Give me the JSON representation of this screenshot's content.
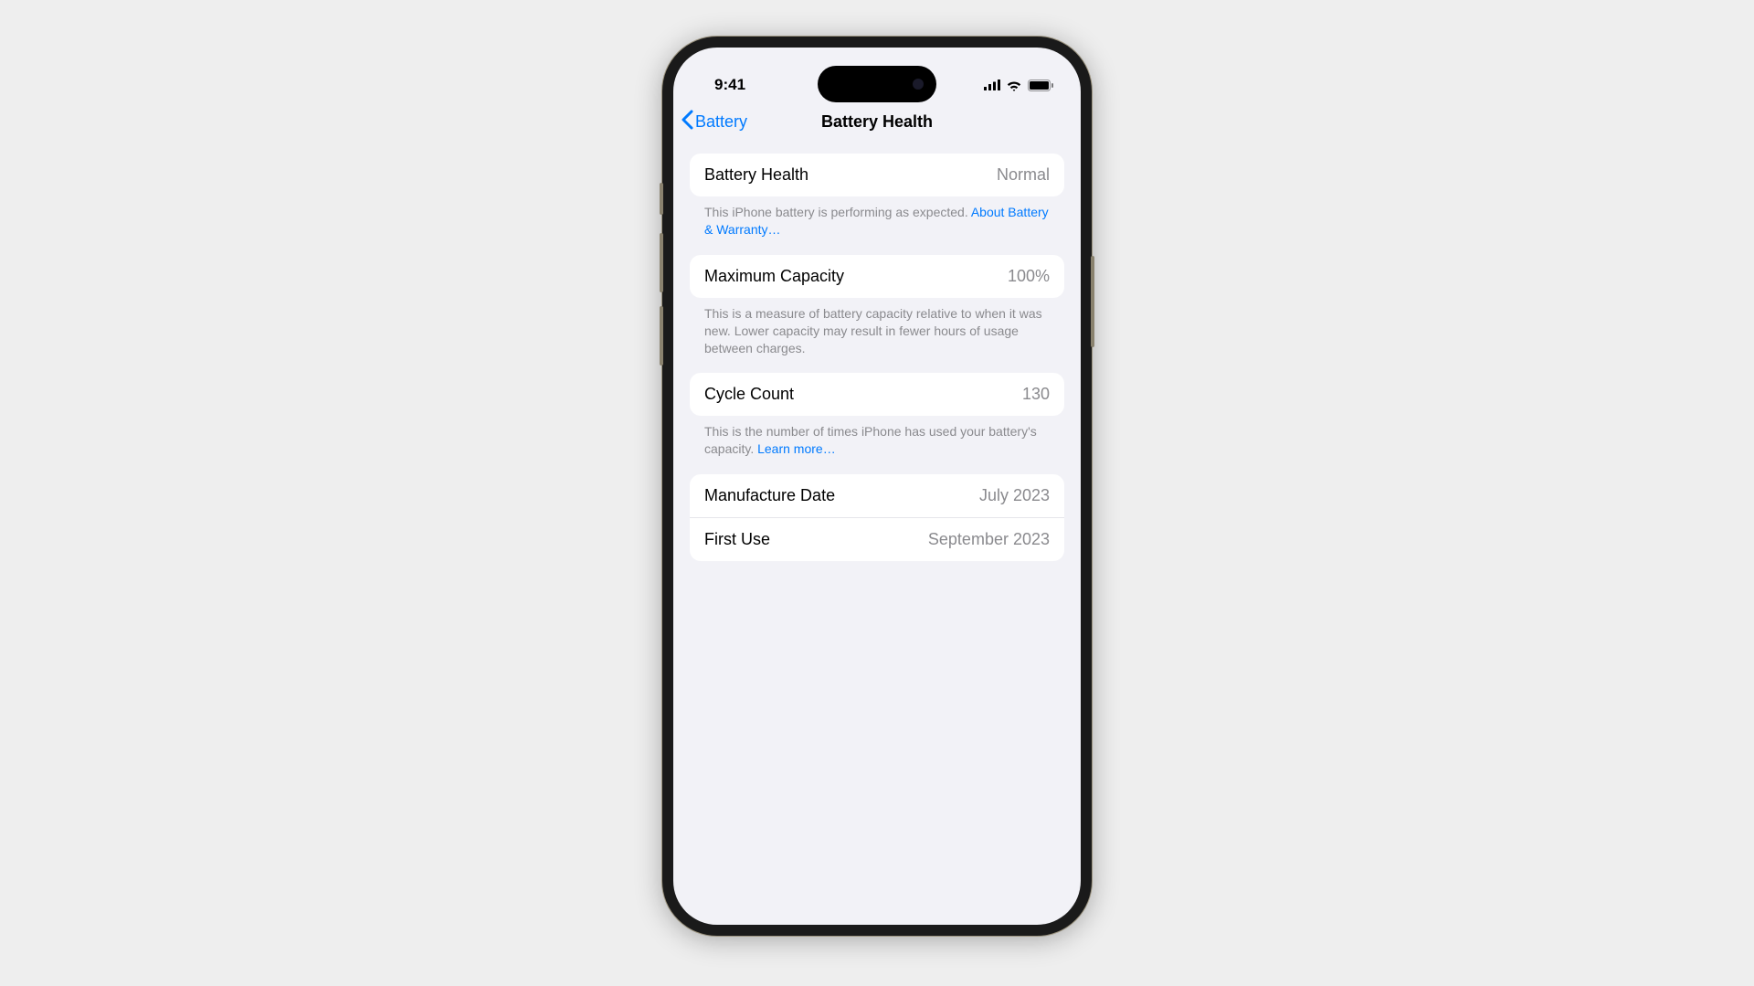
{
  "status": {
    "time": "9:41"
  },
  "nav": {
    "back_label": "Battery",
    "title": "Battery Health"
  },
  "sections": {
    "health": {
      "label": "Battery Health",
      "value": "Normal",
      "footer_text": "This iPhone battery is performing as expected. ",
      "footer_link": "About Battery & Warranty…"
    },
    "capacity": {
      "label": "Maximum Capacity",
      "value": "100%",
      "footer_text": "This is a measure of battery capacity relative to when it was new. Lower capacity may result in fewer hours of usage between charges."
    },
    "cycle": {
      "label": "Cycle Count",
      "value": "130",
      "footer_text": "This is the number of times iPhone has used your battery's capacity. ",
      "footer_link": "Learn more…"
    },
    "dates": {
      "manufacture_label": "Manufacture Date",
      "manufacture_value": "July 2023",
      "first_use_label": "First Use",
      "first_use_value": "September 2023"
    }
  }
}
